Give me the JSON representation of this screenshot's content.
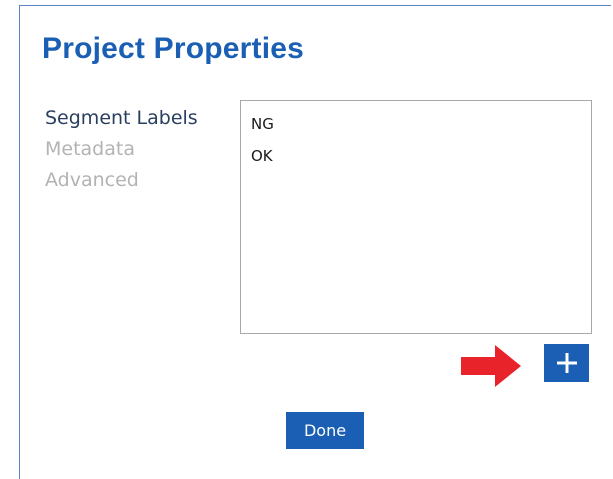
{
  "dialog": {
    "title": "Project Properties"
  },
  "nav": {
    "items": [
      {
        "label": "Segment Labels",
        "state": "active"
      },
      {
        "label": "Metadata",
        "state": "inactive"
      },
      {
        "label": "Advanced",
        "state": "inactive"
      }
    ]
  },
  "labels": {
    "items": [
      "NG",
      "OK"
    ]
  },
  "add_button": {
    "icon": "plus-icon"
  },
  "annotation": {
    "icon": "red-arrow-icon",
    "color": "#e8242a"
  },
  "actions": {
    "done_label": "Done"
  },
  "colors": {
    "accent": "#1a5fb4",
    "nav_active": "#2a3f5f",
    "nav_inactive": "#b3b3b3",
    "border": "#a8a8a8"
  }
}
